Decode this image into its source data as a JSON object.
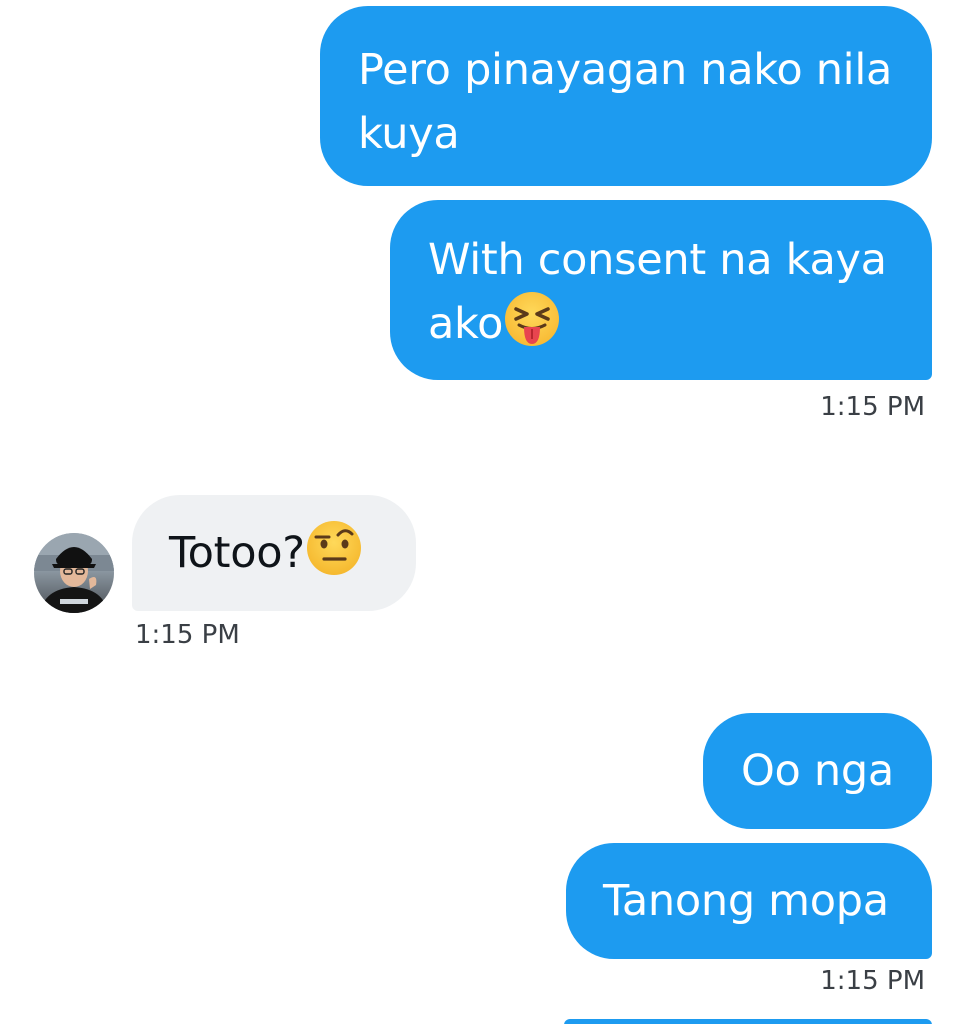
{
  "messages": [
    {
      "direction": "sent",
      "text": "Pero pinayagan nako nila kuya"
    },
    {
      "direction": "sent",
      "text": "With consent na kaya ako",
      "emoji": "squinting-face-with-tongue-icon"
    },
    {
      "direction": "sent",
      "timestamp": "1:15 PM"
    },
    {
      "direction": "received",
      "text": "Totoo?",
      "emoji": "face-with-raised-eyebrow-icon",
      "timestamp": "1:15 PM"
    },
    {
      "direction": "sent",
      "text": "Oo nga"
    },
    {
      "direction": "sent",
      "text": "Tanong mopa",
      "timestamp": "1:15 PM"
    }
  ],
  "colors": {
    "sent_bubble": "#1d9bf0",
    "sent_text": "#ffffff",
    "received_bubble": "#eff1f3",
    "received_text": "#0f1419",
    "timestamp": "#3a3f45"
  }
}
